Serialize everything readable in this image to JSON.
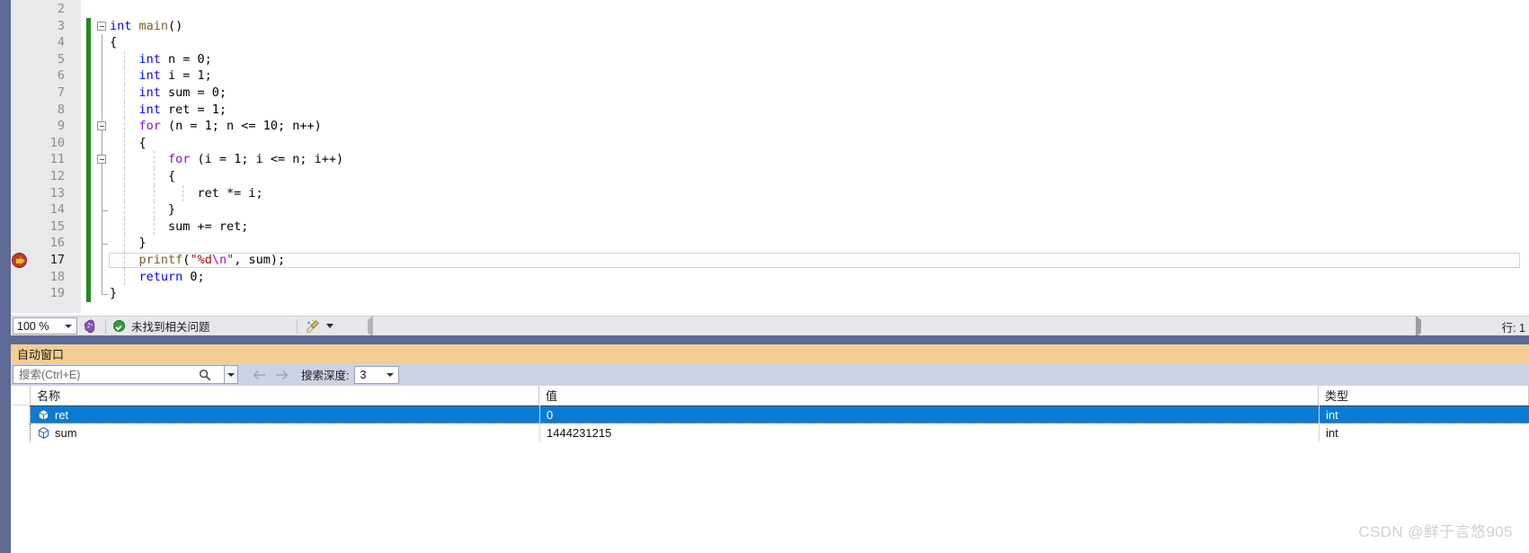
{
  "editor": {
    "zoom_level": "100 %",
    "first_visible_line": 2,
    "current_statement_line": 17,
    "lines": [
      {
        "num": "2",
        "indent": 0,
        "text": ""
      },
      {
        "num": "3",
        "indent": 0,
        "text": "int main()"
      },
      {
        "num": "4",
        "indent": 0,
        "text": "{"
      },
      {
        "num": "5",
        "indent": 1,
        "text": "int n = 0;"
      },
      {
        "num": "6",
        "indent": 1,
        "text": "int i = 1;"
      },
      {
        "num": "7",
        "indent": 1,
        "text": "int sum = 0;"
      },
      {
        "num": "8",
        "indent": 1,
        "text": "int ret = 1;"
      },
      {
        "num": "9",
        "indent": 1,
        "text": "for (n = 1; n <= 10; n++)"
      },
      {
        "num": "10",
        "indent": 1,
        "text": "{"
      },
      {
        "num": "11",
        "indent": 2,
        "text": "for (i = 1; i <= n; i++)"
      },
      {
        "num": "12",
        "indent": 2,
        "text": "{"
      },
      {
        "num": "13",
        "indent": 3,
        "text": "ret *= i;"
      },
      {
        "num": "14",
        "indent": 2,
        "text": "}"
      },
      {
        "num": "15",
        "indent": 2,
        "text": "sum += ret;"
      },
      {
        "num": "16",
        "indent": 1,
        "text": "}"
      },
      {
        "num": "17",
        "indent": 1,
        "text": "printf(\"%d\\n\", sum);"
      },
      {
        "num": "18",
        "indent": 1,
        "text": "return 0;"
      },
      {
        "num": "19",
        "indent": 0,
        "text": "}"
      }
    ]
  },
  "status_bar": {
    "zoom_value": "100 %",
    "intellisense_icon": "brain-icon",
    "problem_status": "未找到相关问题",
    "problem_status_icon": "green-check-icon",
    "cleanup_icon": "broom-icon",
    "scroll_left_icon": "triangle-left-icon",
    "scroll_right_icon": "triangle-right-icon",
    "caret_position": "行: 1"
  },
  "autos_panel": {
    "title": "自动窗口",
    "search": {
      "placeholder": "搜索(Ctrl+E)",
      "value": "",
      "icon": "search-icon",
      "dropdown_icon": "chevron-down-icon"
    },
    "nav": {
      "back_icon": "arrow-left-icon",
      "forward_icon": "arrow-right-icon"
    },
    "depth": {
      "label": "搜索深度:",
      "value": "3",
      "dropdown_icon": "chevron-down-icon"
    },
    "table": {
      "columns": [
        {
          "key": "name",
          "label": "名称"
        },
        {
          "key": "value",
          "label": "值"
        },
        {
          "key": "type",
          "label": "类型"
        }
      ],
      "rows": [
        {
          "icon": "variable-icon",
          "name": "ret",
          "value": "0",
          "type": "int",
          "selected": true
        },
        {
          "icon": "variable-icon",
          "name": "sum",
          "value": "1444231215",
          "type": "int",
          "selected": false
        }
      ]
    }
  },
  "watermark": {
    "text": "CSDN @鲜于言悠905"
  },
  "colors": {
    "window_chrome": "#5d6a96",
    "panel_title_bg": "#f2ce92",
    "toolbar_bg": "#cdd3e4",
    "selection_blue": "#0a7bd4",
    "change_bar_green": "#1e8a1e",
    "status_ok_green": "#2e9e38",
    "keyword_blue": "#0000ff",
    "keyword_purple": "#8f08c4",
    "string_red": "#a31515",
    "function_brown": "#795e26"
  }
}
